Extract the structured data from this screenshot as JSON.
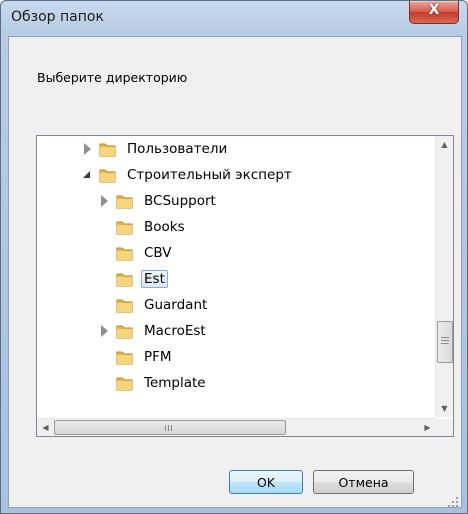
{
  "window": {
    "title": "Обзор папок",
    "close_glyph": "X"
  },
  "prompt": "Выберите директорию",
  "tree": {
    "items": [
      {
        "label": "Пользователи",
        "expander": "collapsed"
      },
      {
        "label": "Строительный эксперт",
        "expander": "expanded"
      },
      {
        "label": "BCSupport",
        "expander": "collapsed"
      },
      {
        "label": "Books",
        "expander": "none"
      },
      {
        "label": "CBV",
        "expander": "none"
      },
      {
        "label": "Est",
        "expander": "none",
        "selected": true
      },
      {
        "label": "Guardant",
        "expander": "none"
      },
      {
        "label": "MacroEst",
        "expander": "collapsed"
      },
      {
        "label": "PFM",
        "expander": "none"
      },
      {
        "label": "Template",
        "expander": "none"
      }
    ]
  },
  "buttons": {
    "ok": "OK",
    "cancel": "Отмена"
  },
  "colors": {
    "folder": "#e8b84a",
    "selection_border": "#84acdd"
  },
  "icons": {
    "scroll_up": "▲",
    "scroll_down": "▼",
    "scroll_left": "◀",
    "scroll_right": "▶"
  }
}
